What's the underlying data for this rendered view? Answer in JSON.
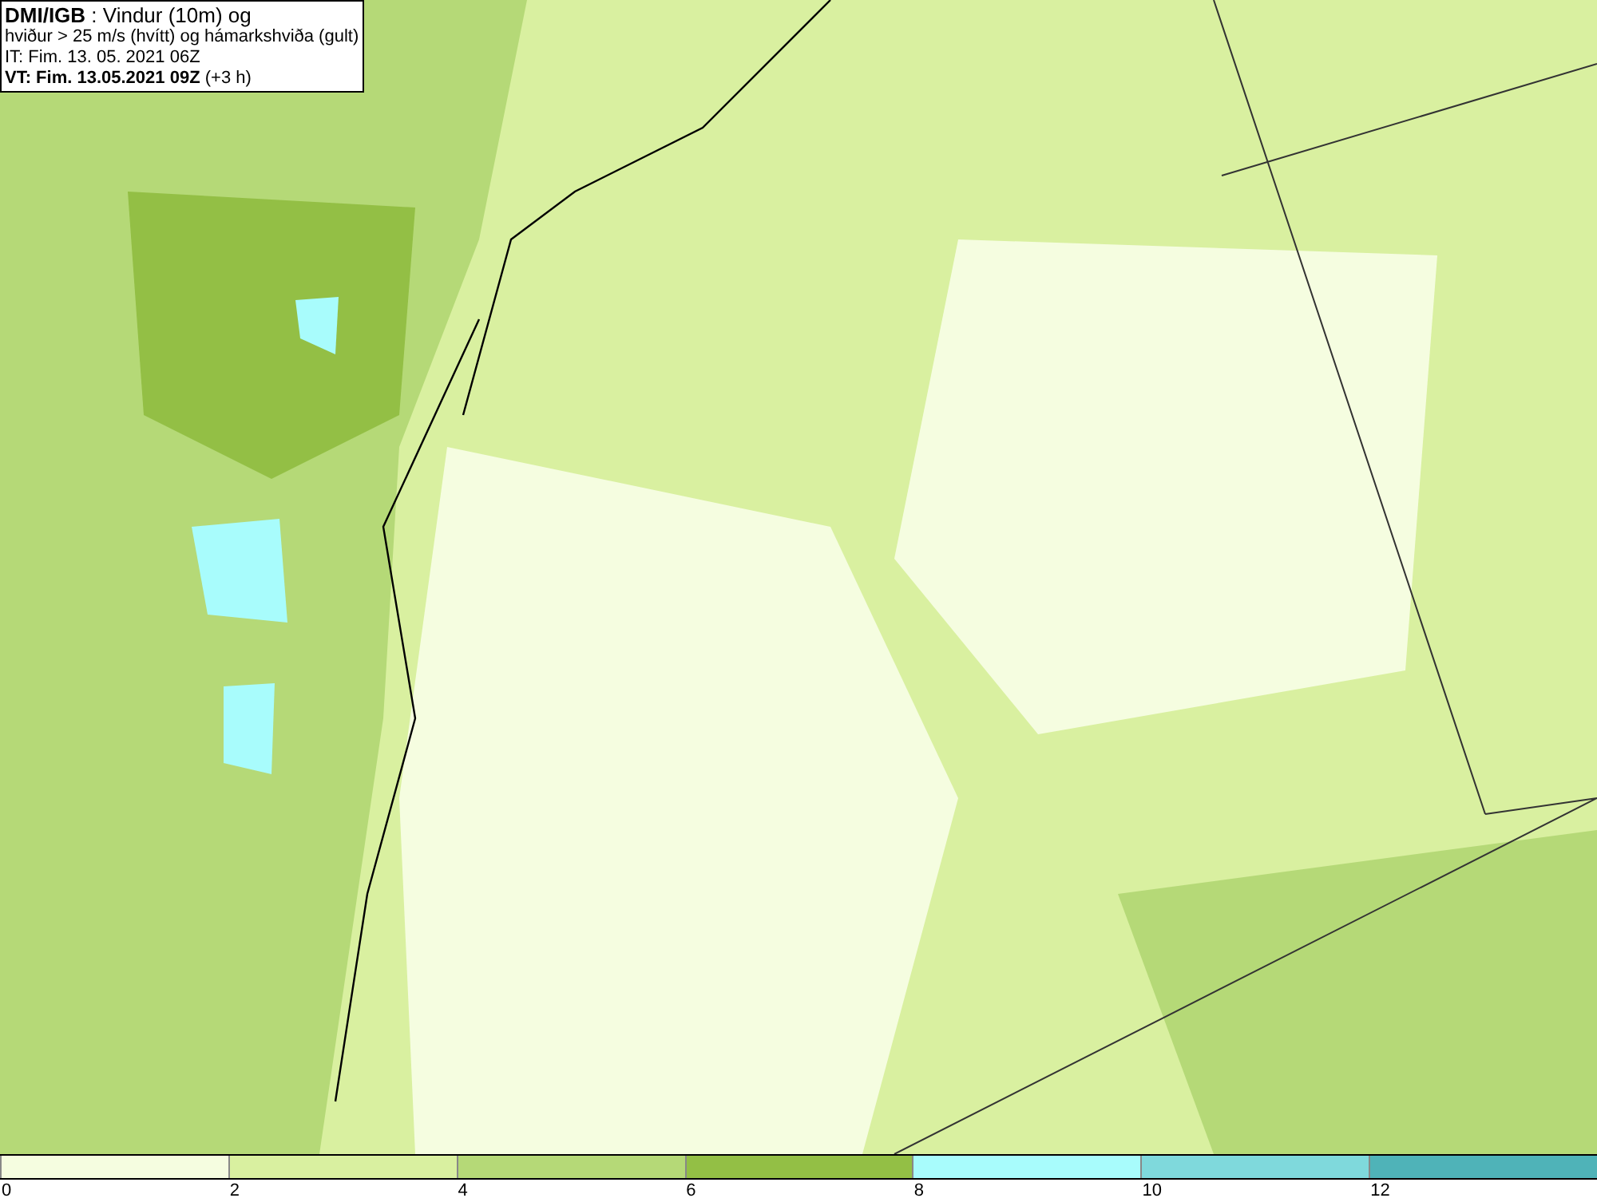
{
  "header": {
    "lines": [
      "**DMI/IGB** : Vindur (10m) og",
      "hviður > 25 m/s (hvítt) og hámarkshviða (gult)",
      "IT: Fim. 13. 05. 2021 06Z",
      "**VT: Fim. 13.05.2021 09Z** (+3 h)"
    ]
  },
  "legend": {
    "bins": [
      {
        "color": "#f5fde0"
      },
      {
        "color": "#d9f0a0"
      },
      {
        "color": "#b5d977"
      },
      {
        "color": "#93bf45"
      },
      {
        "color": "#a8fcfc"
      },
      {
        "color": "#7fd9dc"
      },
      {
        "color": "#4fb3b8"
      }
    ],
    "labels": [
      "0",
      "2",
      "4",
      "6",
      "8",
      "10",
      "12"
    ]
  }
}
